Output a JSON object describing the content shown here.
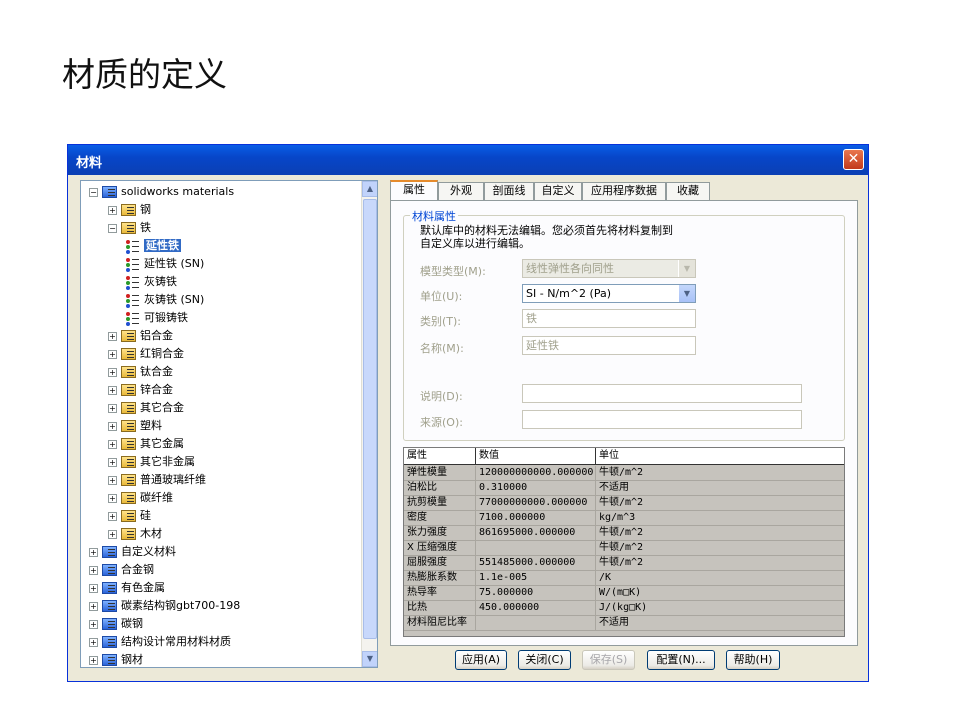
{
  "slide_title": "材质的定义",
  "dialog": {
    "title": "材料",
    "close_glyph": "✕"
  },
  "tree": {
    "root": "solidworks materials",
    "items": [
      {
        "label": "钢",
        "level": 1,
        "kind": "folder",
        "toggle": "+"
      },
      {
        "label": "铁",
        "level": 1,
        "kind": "folder",
        "toggle": "−"
      },
      {
        "label": "延性铁",
        "level": 2,
        "kind": "material",
        "selected": true
      },
      {
        "label": "延性铁 (SN)",
        "level": 2,
        "kind": "material"
      },
      {
        "label": "灰铸铁",
        "level": 2,
        "kind": "material"
      },
      {
        "label": "灰铸铁 (SN)",
        "level": 2,
        "kind": "material"
      },
      {
        "label": "可锻铸铁",
        "level": 2,
        "kind": "material"
      },
      {
        "label": "铝合金",
        "level": 1,
        "kind": "folder",
        "toggle": "+"
      },
      {
        "label": "红铜合金",
        "level": 1,
        "kind": "folder",
        "toggle": "+"
      },
      {
        "label": "钛合金",
        "level": 1,
        "kind": "folder",
        "toggle": "+"
      },
      {
        "label": "锌合金",
        "level": 1,
        "kind": "folder",
        "toggle": "+"
      },
      {
        "label": "其它合金",
        "level": 1,
        "kind": "folder",
        "toggle": "+"
      },
      {
        "label": "塑料",
        "level": 1,
        "kind": "folder",
        "toggle": "+"
      },
      {
        "label": "其它金属",
        "level": 1,
        "kind": "folder",
        "toggle": "+"
      },
      {
        "label": "其它非金属",
        "level": 1,
        "kind": "folder",
        "toggle": "+"
      },
      {
        "label": "普通玻璃纤维",
        "level": 1,
        "kind": "folder",
        "toggle": "+"
      },
      {
        "label": "碳纤维",
        "level": 1,
        "kind": "folder",
        "toggle": "+"
      },
      {
        "label": "硅",
        "level": 1,
        "kind": "folder",
        "toggle": "+"
      },
      {
        "label": "木材",
        "level": 1,
        "kind": "folder",
        "toggle": "+"
      },
      {
        "label": "自定义材料",
        "level": 0,
        "kind": "library",
        "toggle": "+"
      },
      {
        "label": "合金钢",
        "level": 0,
        "kind": "library",
        "toggle": "+"
      },
      {
        "label": "有色金属",
        "level": 0,
        "kind": "library",
        "toggle": "+"
      },
      {
        "label": "碳素结构钢gbt700-198",
        "level": 0,
        "kind": "library",
        "toggle": "+"
      },
      {
        "label": "碳钢",
        "level": 0,
        "kind": "library",
        "toggle": "+"
      },
      {
        "label": "结构设计常用材料材质",
        "level": 0,
        "kind": "library",
        "toggle": "+"
      },
      {
        "label": "钢材",
        "level": 0,
        "kind": "library",
        "toggle": "+"
      }
    ]
  },
  "tabs": [
    "属性",
    "外观",
    "剖面线",
    "自定义",
    "应用程序数据",
    "收藏"
  ],
  "active_tab": "属性",
  "properties": {
    "group_title": "材料属性",
    "info_line1": "默认库中的材料无法编辑。您必须首先将材料复制到",
    "info_line2": "自定义库以进行编辑。",
    "model_type_label": "模型类型(M):",
    "model_type_value": "线性弹性各向同性",
    "unit_label": "单位(U):",
    "unit_value": "SI - N/m^2 (Pa)",
    "category_label": "类别(T):",
    "category_value": "铁",
    "name_label": "名称(M):",
    "name_value": "延性铁",
    "description_label": "说明(D):",
    "description_value": "",
    "source_label": "来源(O):",
    "source_value": ""
  },
  "prop_table": {
    "headers": [
      "属性",
      "数值",
      "单位"
    ],
    "rows": [
      [
        "弹性模量",
        "120000000000.000000",
        "牛顿/m^2"
      ],
      [
        "泊松比",
        "0.310000",
        "不适用"
      ],
      [
        "抗剪模量",
        "77000000000.000000",
        "牛顿/m^2"
      ],
      [
        "密度",
        "7100.000000",
        "kg/m^3"
      ],
      [
        "张力强度",
        "861695000.000000",
        "牛顿/m^2"
      ],
      [
        "X 压缩强度",
        "",
        "牛顿/m^2"
      ],
      [
        "屈服强度",
        "551485000.000000",
        "牛顿/m^2"
      ],
      [
        "热膨胀系数",
        "1.1e-005",
        "/K"
      ],
      [
        "热导率",
        "75.000000",
        "W/(m□K)"
      ],
      [
        "比热",
        "450.000000",
        "J/(kg□K)"
      ],
      [
        "材料阻尼比率",
        "",
        "不适用"
      ]
    ]
  },
  "buttons": {
    "apply": "应用(A)",
    "close": "关闭(C)",
    "save": "保存(S)",
    "config": "配置(N)...",
    "help": "帮助(H)"
  }
}
